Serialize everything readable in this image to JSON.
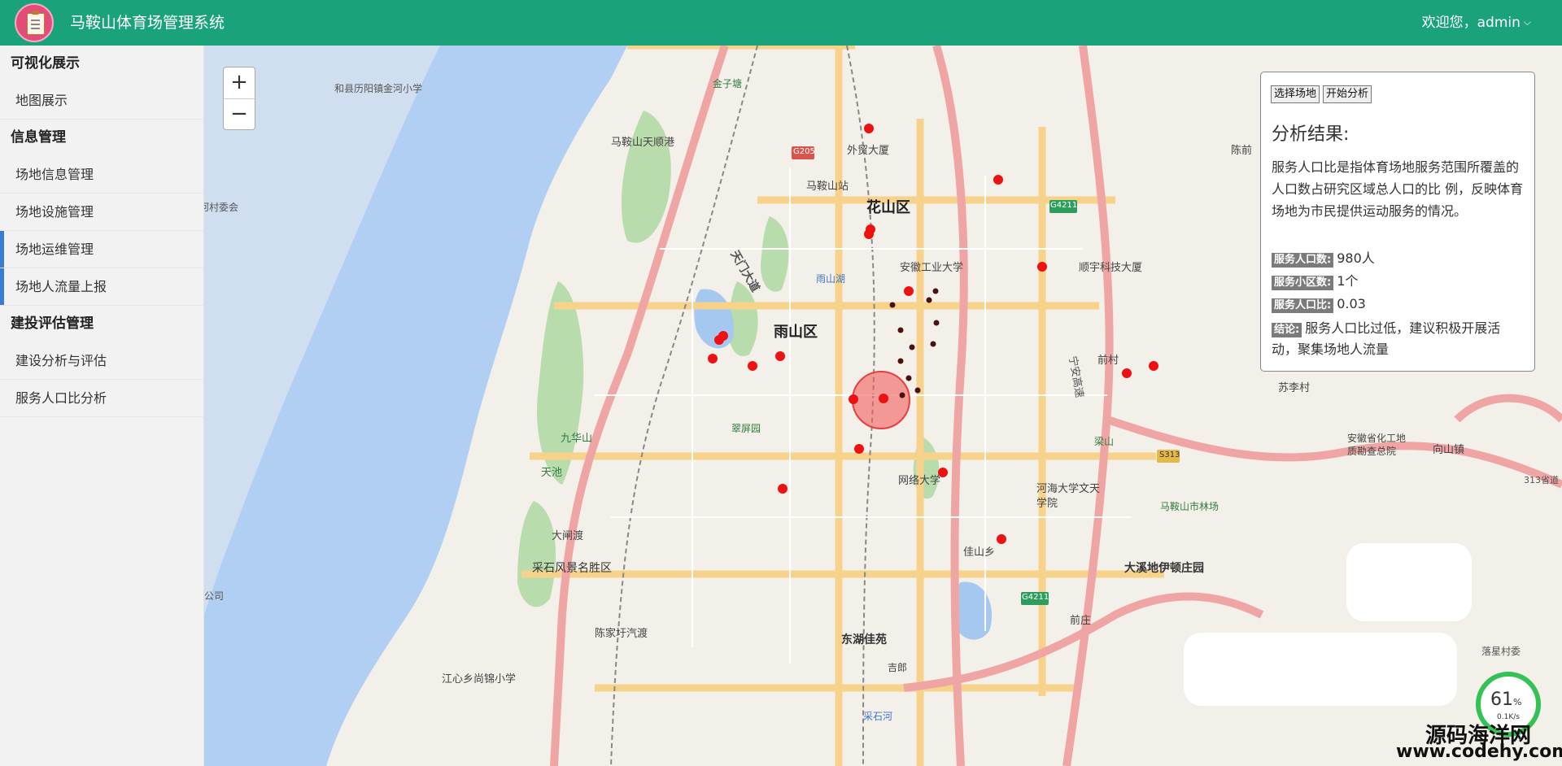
{
  "header": {
    "app_title": "马鞍山体育场管理系统",
    "user_greeting": "欢迎您，admin",
    "brand_color": "#1aa37a"
  },
  "sidebar": {
    "groups": [
      {
        "title": "可视化展示",
        "items": [
          {
            "label": "地图展示"
          }
        ]
      },
      {
        "title": "信息管理",
        "items": [
          {
            "label": "场地信息管理"
          },
          {
            "label": "场地设施管理"
          },
          {
            "label": "场地运维管理"
          },
          {
            "label": "场地人流量上报"
          }
        ]
      },
      {
        "title": "建投评估管理",
        "items": [
          {
            "label": "建设分析与评估"
          },
          {
            "label": "服务人口比分析"
          }
        ]
      }
    ]
  },
  "map": {
    "zoom_in": "+",
    "zoom_out": "−",
    "labels": {
      "huashan": "花山区",
      "yushan": "雨山区",
      "waimao": "外贸大厦",
      "maanshan_station": "马鞍山站",
      "anhui_gongye": "安徽工业大学",
      "shunyu": "顺宇科技大厦",
      "yushanhu": "雨山湖",
      "tianmen": "天门大道",
      "ningan": "宁安高速",
      "qiancun": "前村",
      "sulicun": "苏李村",
      "jiahsan": "佳山乡",
      "dongh": "东湖佳苑",
      "dazu": "大溪地伊顿庄园",
      "hehai": "河海大学文天学院",
      "wangluo": "网络大学",
      "caishi": "采石风景名胜区",
      "dazha": "大闸渡",
      "chenjiayu": "陈家圩汽渡",
      "jiangxin": "江心乡尚锦小学",
      "jiuhua": "九华山",
      "tianchi": "天池",
      "tiangang": "马鞍山天顺港",
      "hexian": "和县历阳镇金河小学",
      "jinzi": "金子塘",
      "xiangshan": "向山镇",
      "anhui_dizhi": "安徽省化工地质勘查总院",
      "linchang": "马鞍山市林场",
      "chenxiang": "陈前",
      "qianzhuang": "前庄",
      "road_g205": "G205",
      "road_g4211": "G4211",
      "road_s313": "S313",
      "road_313": "313省道",
      "cuiping": "翠屏园",
      "ji": "吉郎",
      "caishihe": "采石河",
      "hecun": "河村委会",
      "luohe": "落星村委",
      "liangshan": "梁山",
      "hugong": "公司"
    }
  },
  "panel": {
    "btn_select": "选择场地",
    "btn_analyze": "开始分析",
    "result_title": "分析结果:",
    "description": "服务人口比是指体育场地服务范围所覆盖的人口数占研究区域总人口的比 例，反映体育场地为市民提供运动服务的情况。",
    "service_population_label": "服务人口数:",
    "service_population_value": "980人",
    "service_community_label": "服务小区数:",
    "service_community_value": "1个",
    "service_ratio_label": "服务人口比:",
    "service_ratio_value": "0.03",
    "conclusion_label": "结论:",
    "conclusion_value": "服务人口比过低，建议积极开展活动，聚集场地人流量"
  },
  "gauge": {
    "percent": "61",
    "percent_unit": "%",
    "speed": "0.1K/s"
  },
  "watermark": {
    "line1": "源码海洋网",
    "line2": "www.codehy.com"
  }
}
